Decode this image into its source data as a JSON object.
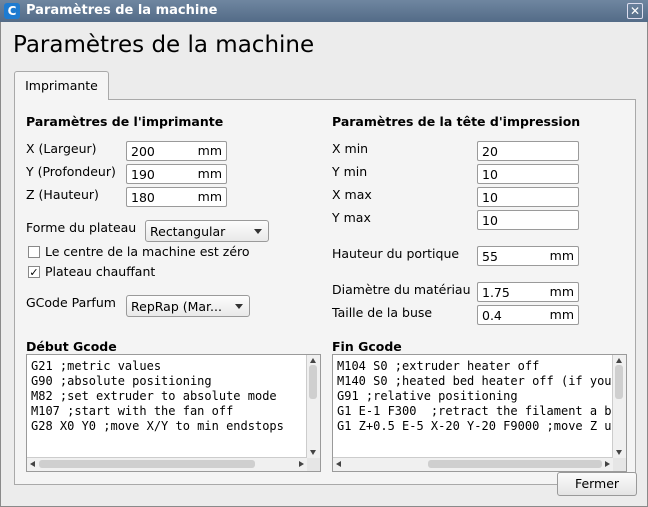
{
  "window": {
    "title": "Paramètres de la machine",
    "close_glyph": "✕",
    "app_icon_glyph": "C"
  },
  "page_title": "Paramètres de la machine",
  "tabs": [
    {
      "label": "Imprimante"
    }
  ],
  "printer": {
    "section_title": "Paramètres de l'imprimante",
    "x": {
      "label": "X (Largeur)",
      "value": "200",
      "unit": "mm"
    },
    "y": {
      "label": "Y (Profondeur)",
      "value": "190",
      "unit": "mm"
    },
    "z": {
      "label": "Z (Hauteur)",
      "value": "180",
      "unit": "mm"
    },
    "build_plate": {
      "label": "Forme du plateau",
      "value": "Rectangular"
    },
    "origin_center": {
      "label": "Le centre de la machine est zéro",
      "checked": false
    },
    "heated_bed": {
      "label": "Plateau chauffant",
      "checked": true,
      "check_glyph": "✓"
    },
    "gcode_flavor": {
      "label": "GCode Parfum",
      "value": "RepRap (Mar..."
    }
  },
  "printhead": {
    "section_title": "Paramètres de la tête d'impression",
    "xmin": {
      "label": "X min",
      "value": "20"
    },
    "ymin": {
      "label": "Y min",
      "value": "10"
    },
    "xmax": {
      "label": "X max",
      "value": "10"
    },
    "ymax": {
      "label": "Y max",
      "value": "10"
    },
    "gantry": {
      "label": "Hauteur du portique",
      "value": "55",
      "unit": "mm"
    },
    "material_diameter": {
      "label": "Diamètre du matériau",
      "value": "1.75",
      "unit": "mm"
    },
    "nozzle_size": {
      "label": "Taille de la buse",
      "value": "0.4",
      "unit": "mm"
    }
  },
  "start_gcode": {
    "title": "Début Gcode",
    "text": "G21 ;metric values\nG90 ;absolute positioning\nM82 ;set extruder to absolute mode\nM107 ;start with the fan off\nG28 X0 Y0 ;move X/Y to min endstops"
  },
  "end_gcode": {
    "title": "Fin Gcode",
    "text": "M104 S0 ;extruder heater off\nM140 S0 ;heated bed heater off (if you\nG91 ;relative positioning\nG1 E-1 F300  ;retract the filament a b\nG1 Z+0.5 E-5 X-20 Y-20 F9000 ;move Z u"
  },
  "close_button": "Fermer"
}
